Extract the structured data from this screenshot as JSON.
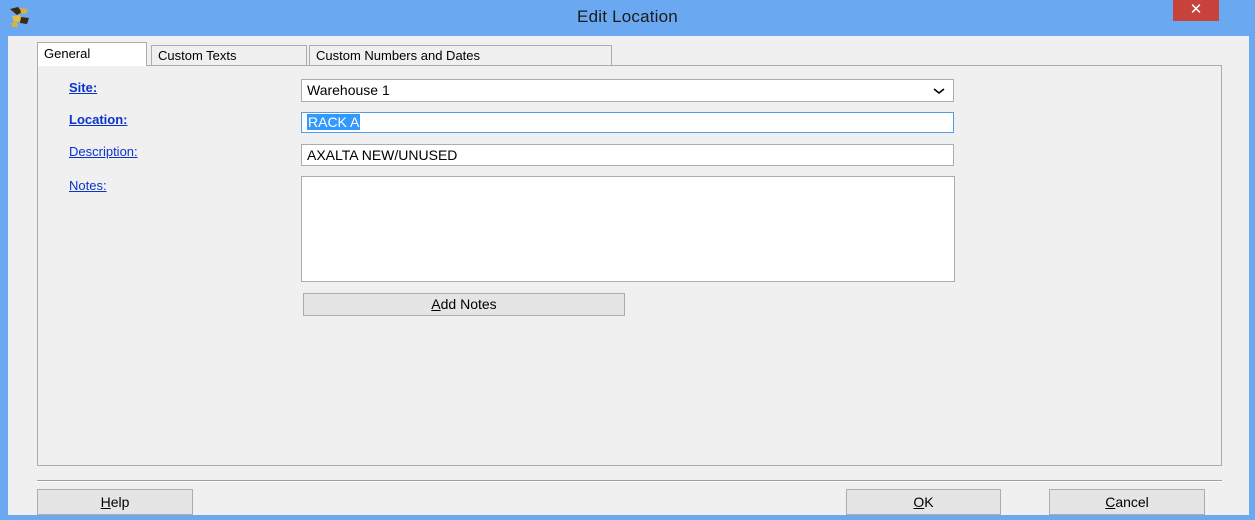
{
  "window": {
    "title": "Edit Location",
    "close_symbol": "✕"
  },
  "tabs": [
    {
      "label": "General"
    },
    {
      "label": "Custom Texts"
    },
    {
      "label": "Custom Numbers and Dates"
    }
  ],
  "form": {
    "site_label": "Site:",
    "site_value": "Warehouse 1",
    "location_label": "Location:",
    "location_value": "RACK A",
    "description_label": "Description:",
    "description_value": "AXALTA NEW/UNUSED",
    "notes_label": "Notes:",
    "notes_value": "",
    "add_notes_button": {
      "mnemonic": "A",
      "rest": "dd Notes"
    }
  },
  "footer": {
    "help_button": {
      "mnemonic": "H",
      "rest": "elp"
    },
    "ok_button": {
      "mnemonic": "O",
      "rest": "K"
    },
    "cancel_button": {
      "mnemonic": "C",
      "rest": "ancel"
    }
  },
  "icons": {
    "app": "app-icon",
    "dropdown": "chevron-down-icon",
    "close": "close-icon"
  },
  "colors": {
    "titlebar": "#6aa9f2",
    "close": "#c7423a",
    "link_label": "#0a33cc",
    "selection": "#3399ff"
  }
}
